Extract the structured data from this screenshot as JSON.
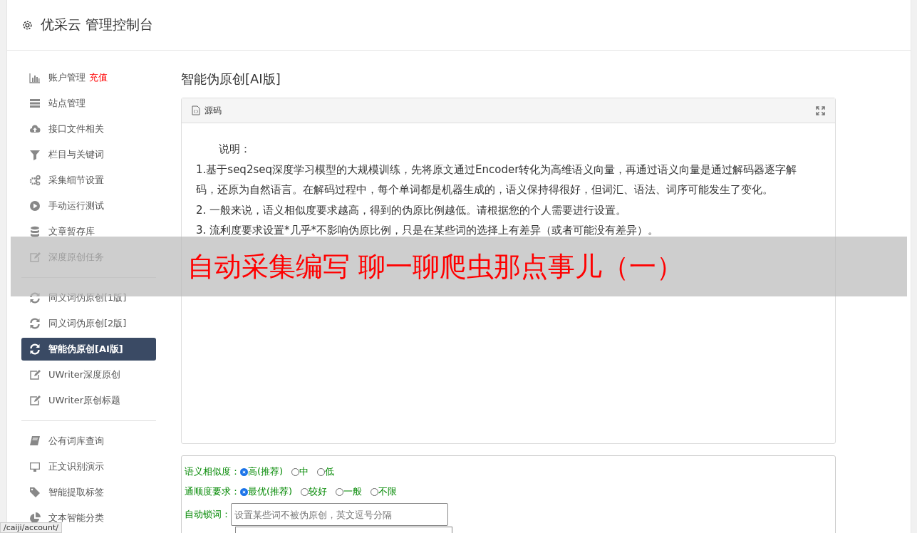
{
  "header": {
    "title": "优采云 管理控制台"
  },
  "sidebar": {
    "groups": [
      {
        "items": [
          {
            "label": "账户管理",
            "badge": "充值",
            "selected": false
          },
          {
            "label": "站点管理",
            "selected": false
          },
          {
            "label": "接口文件相关",
            "selected": false
          },
          {
            "label": "栏目与关键词",
            "selected": false
          },
          {
            "label": "采集细节设置",
            "selected": false
          },
          {
            "label": "手动运行测试",
            "selected": false
          },
          {
            "label": "文章暂存库",
            "selected": false
          },
          {
            "label": "深度原创任务",
            "selected": false
          }
        ]
      },
      {
        "items": [
          {
            "label": "同义词伪原创[1版]",
            "selected": false
          },
          {
            "label": "同义词伪原创[2版]",
            "selected": false
          },
          {
            "label": "智能伪原创[AI版]",
            "selected": true
          },
          {
            "label": "UWriter深度原创",
            "selected": false
          },
          {
            "label": "UWriter原创标题",
            "selected": false
          }
        ]
      },
      {
        "items": [
          {
            "label": "公有词库查询",
            "selected": false
          },
          {
            "label": "正文识别演示",
            "selected": false
          },
          {
            "label": "智能提取标签",
            "selected": false
          },
          {
            "label": "文本智能分类",
            "selected": false
          }
        ]
      }
    ]
  },
  "page": {
    "title": "智能伪原创[AI版]",
    "editor": {
      "toolbar_label": "源码",
      "lines": [
        "说明：",
        "1.基于seq2seq深度学习模型的大规模训练，先将原文通过Encoder转化为高维语义向量，再通过语义向量是通过解码器逐字解码，还原为自然语言。在解码过程中，每个单词都是机器生成的，语义保持得很好，但词汇、语法、词序可能发生了变化。",
        "2. 一般来说，语义相似度要求越高，得到的伪原比例越低。请根据您的个人需要进行设置。",
        "3. 流利度要求设置*几乎*不影响伪原比例，只是在某些词的选择上有差异（或者可能没有差异）。"
      ]
    },
    "options": [
      {
        "label": "语义相似度：",
        "choices": [
          {
            "label": "高(推荐)",
            "selected": true
          },
          {
            "label": "中",
            "selected": false
          },
          {
            "label": "低",
            "selected": false
          }
        ]
      },
      {
        "label": "通顺度要求：",
        "choices": [
          {
            "label": "最优(推荐)",
            "selected": true
          },
          {
            "label": "较好",
            "selected": false
          },
          {
            "label": "一般",
            "selected": false
          },
          {
            "label": "不限",
            "selected": false
          }
        ]
      }
    ],
    "lock_words": {
      "label": "自动锁词：",
      "placeholder": "设置某些词不被伪原创，英文逗号分隔"
    }
  },
  "overlay_banner": "自动采集编写 聊一聊爬虫那点事儿（一）",
  "status_bar": "/caiji/account/"
}
